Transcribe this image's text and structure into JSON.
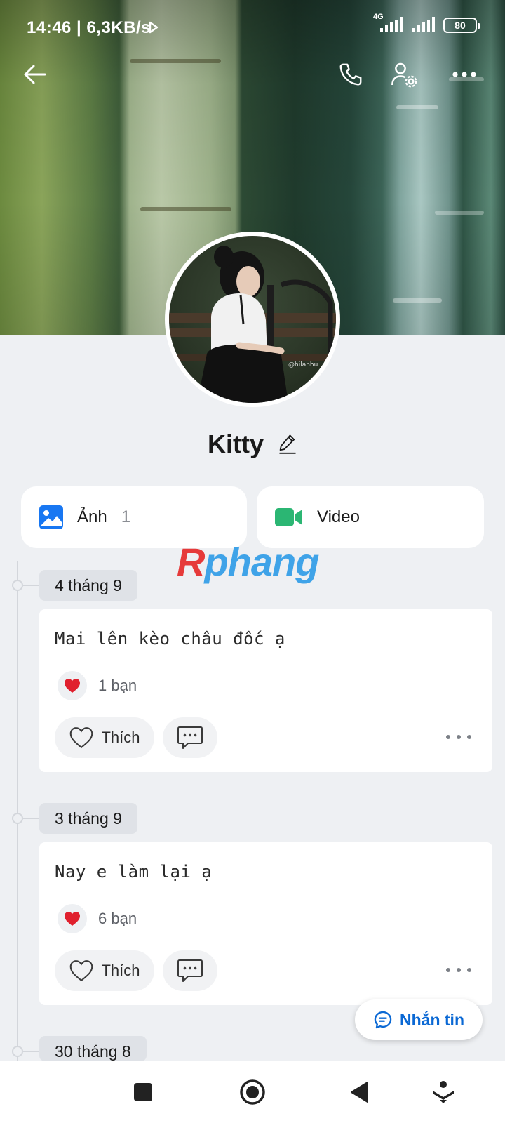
{
  "status_bar": {
    "time_speed": "14:46 | 6,3KB/s",
    "network": "4G",
    "battery": "80"
  },
  "top_bar": {
    "icons": [
      "back-arrow-icon",
      "phone-call-icon",
      "profile-settings-icon",
      "more-icon"
    ]
  },
  "profile": {
    "name": "Kitty",
    "avatar_watermark": "@hilanhu"
  },
  "media": {
    "photos_label": "Ảnh",
    "photos_count": "1",
    "video_label": "Video"
  },
  "watermark": {
    "first_letter": "R",
    "rest": "phang"
  },
  "posts": [
    {
      "date": "4 tháng 9",
      "text": "Mai lên kèo châu đốc ạ",
      "reaction_count": "1 bạn",
      "like_label": "Thích"
    },
    {
      "date": "3 tháng 9",
      "text": "Nay e làm lại ạ",
      "reaction_count": "6 bạn",
      "like_label": "Thích"
    }
  ],
  "next_date": "30 tháng 8",
  "fab": {
    "message_label": "Nhắn tin"
  },
  "colors": {
    "accent": "#0a68d4",
    "photo_icon": "#1877f2",
    "video_icon": "#2bb673",
    "heart": "#e0202e",
    "background": "#eef0f3"
  }
}
